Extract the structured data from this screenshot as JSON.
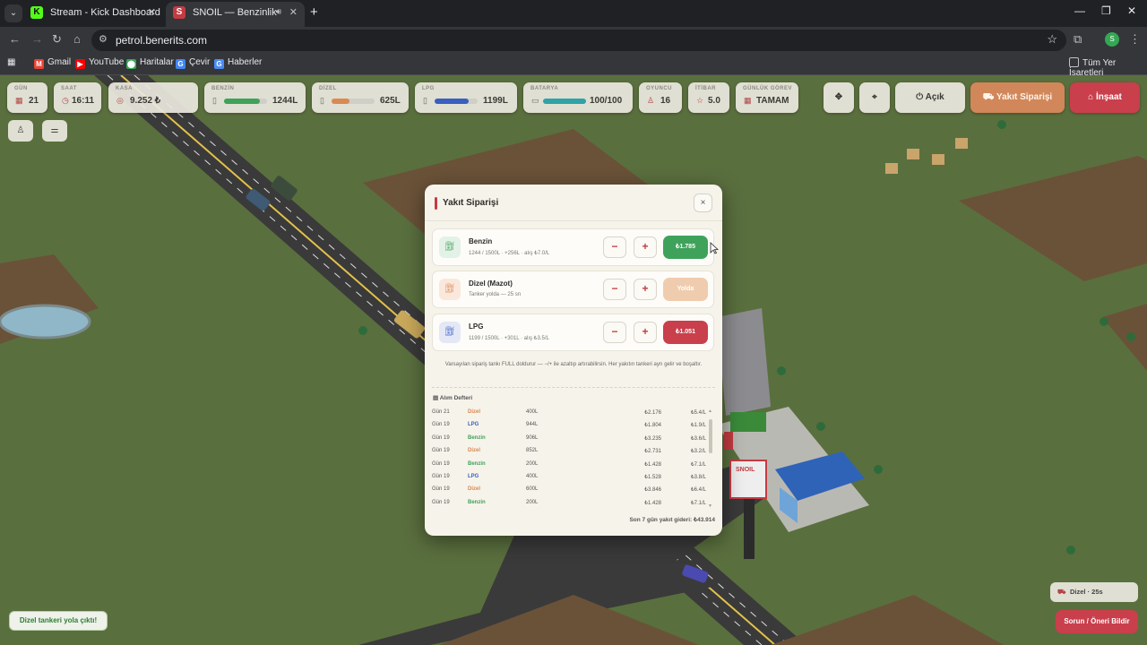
{
  "browser": {
    "tabs": [
      {
        "title": "Stream - Kick Dashboard",
        "favicon": "K"
      },
      {
        "title": "SNOIL — Benzinlik",
        "favicon": "S"
      }
    ],
    "url": "petrol.benerits.com",
    "profile_initial": "S",
    "bookmarks": [
      "Gmail",
      "YouTube",
      "Haritalar",
      "Çevir",
      "Haberler"
    ],
    "all_bookmarks": "Tüm Yer İşaretleri"
  },
  "hud": {
    "gun": {
      "label": "GÜN",
      "value": "21"
    },
    "saat": {
      "label": "SAAT",
      "value": "16:11"
    },
    "kasa": {
      "label": "KASA",
      "value": "9.252 ₺"
    },
    "benzin": {
      "label": "BENZİN",
      "value": "1244L",
      "level": 0.83,
      "color": "#3fa25a"
    },
    "dizel": {
      "label": "DİZEL",
      "value": "625L",
      "level": 0.42,
      "color": "#d98a52"
    },
    "lpg": {
      "label": "LPG",
      "value": "1199L",
      "level": 0.8,
      "color": "#3b5fc0"
    },
    "batarya": {
      "label": "BATARYA",
      "value": "100/100",
      "level": 1.0,
      "color": "#2fa3a6"
    },
    "oyuncu": {
      "label": "OYUNCU",
      "value": "16"
    },
    "itibar": {
      "label": "İTİBAR",
      "value": "5.0"
    },
    "gorev": {
      "label": "GÜNLÜK GÖREV",
      "value": "TAMAM"
    },
    "open_label": "Açık",
    "fuel_order_label": "Yakıt Siparişi",
    "build_label": "İnşaat"
  },
  "modal": {
    "title": "Yakıt Siparişi",
    "close": "×",
    "fuels": [
      {
        "name": "Benzin",
        "sub": "1244 / 1500L · +256L · alış ₺7.0/L",
        "button": "₺1.785",
        "button_color": "#3fa25a",
        "icon_bg": "#e3f2e6",
        "icon_color": "#3fa25a"
      },
      {
        "name": "Dizel (Mazot)",
        "sub": "Tanker yolda — 25 sn",
        "button": "Yolda",
        "button_color": "#f0ccae",
        "icon_bg": "#fbe8dc",
        "icon_color": "#d98a52"
      },
      {
        "name": "LPG",
        "sub": "1199 / 1500L · +301L · alış ₺3.5/L",
        "button": "₺1.051",
        "button_color": "#c93f4b",
        "icon_bg": "#e4e8f6",
        "icon_color": "#3b5fc0"
      }
    ],
    "minus": "−",
    "plus": "+",
    "note": "Varsayılan sipariş tankı FULL doldurur — −/+ ile azaltıp artırabilirsin. Her yakıtın tankeri ayrı gelir ve boşaltır.",
    "ledger_title": "Alım Defteri",
    "ledger": [
      {
        "day": "Gün 21",
        "fuel": "Dizel",
        "qty": "400L",
        "total": "₺2.176",
        "price": "₺5.4/L",
        "color": "#d98a52"
      },
      {
        "day": "Gün 19",
        "fuel": "LPG",
        "qty": "944L",
        "total": "₺1.804",
        "price": "₺1.9/L",
        "color": "#3b5fc0"
      },
      {
        "day": "Gün 19",
        "fuel": "Benzin",
        "qty": "906L",
        "total": "₺3.235",
        "price": "₺3.6/L",
        "color": "#3fa25a"
      },
      {
        "day": "Gün 19",
        "fuel": "Dizel",
        "qty": "852L",
        "total": "₺2.731",
        "price": "₺3.2/L",
        "color": "#d98a52"
      },
      {
        "day": "Gün 19",
        "fuel": "Benzin",
        "qty": "200L",
        "total": "₺1.428",
        "price": "₺7.1/L",
        "color": "#3fa25a"
      },
      {
        "day": "Gün 19",
        "fuel": "LPG",
        "qty": "400L",
        "total": "₺1.528",
        "price": "₺3.8/L",
        "color": "#3b5fc0"
      },
      {
        "day": "Gün 19",
        "fuel": "Dizel",
        "qty": "600L",
        "total": "₺3.846",
        "price": "₺6.4/L",
        "color": "#d98a52"
      },
      {
        "day": "Gün 19",
        "fuel": "Benzin",
        "qty": "200L",
        "total": "₺1.428",
        "price": "₺7.1/L",
        "color": "#3fa25a"
      }
    ],
    "total": "Son 7 gün yakıt gideri: ₺43.914"
  },
  "toast": "Dizel tankeri yola çıktı!",
  "status_pill": "Dizel · 25s",
  "report_button": "Sorun / Öneri Bildir",
  "sign_text": "SNOIL"
}
